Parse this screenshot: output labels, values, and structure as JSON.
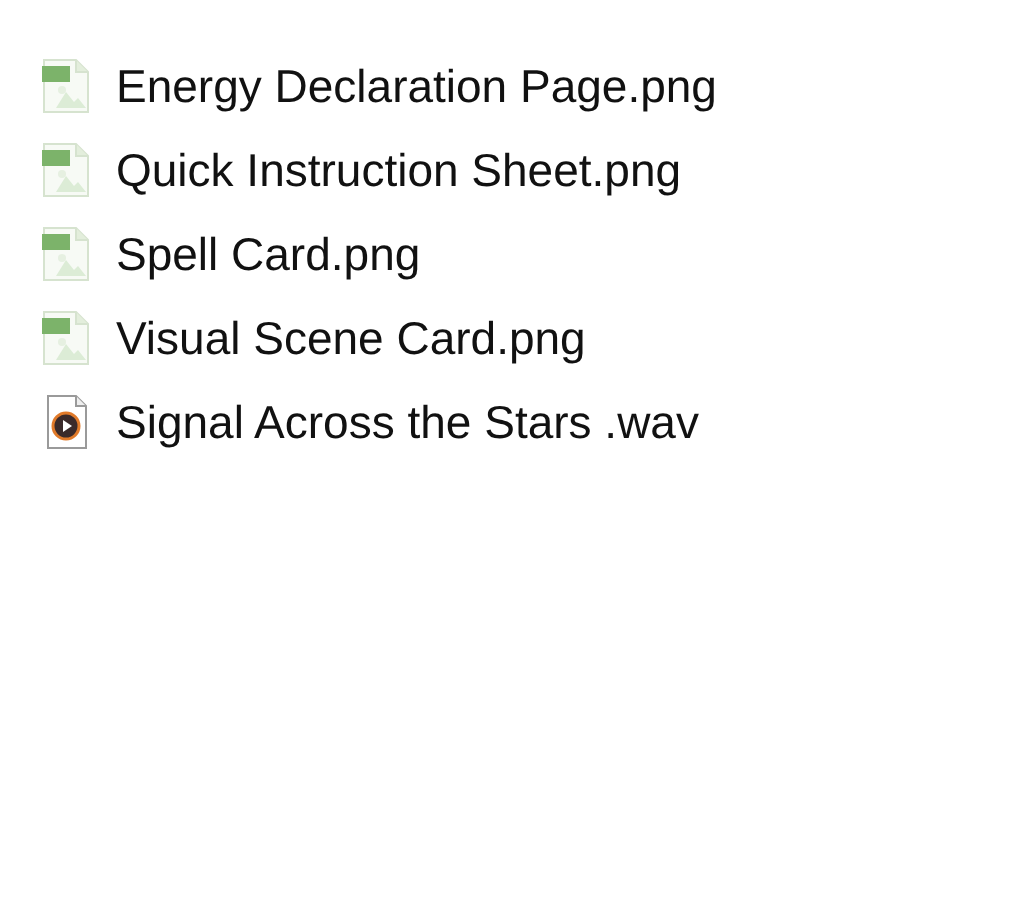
{
  "files": [
    {
      "name": "Energy Declaration Page.png",
      "kind": "image"
    },
    {
      "name": "Quick Instruction Sheet.png",
      "kind": "image"
    },
    {
      "name": "Spell Card.png",
      "kind": "image"
    },
    {
      "name": "Visual Scene Card.png",
      "kind": "image"
    },
    {
      "name": "Signal Across the Stars .wav",
      "kind": "audio"
    }
  ]
}
